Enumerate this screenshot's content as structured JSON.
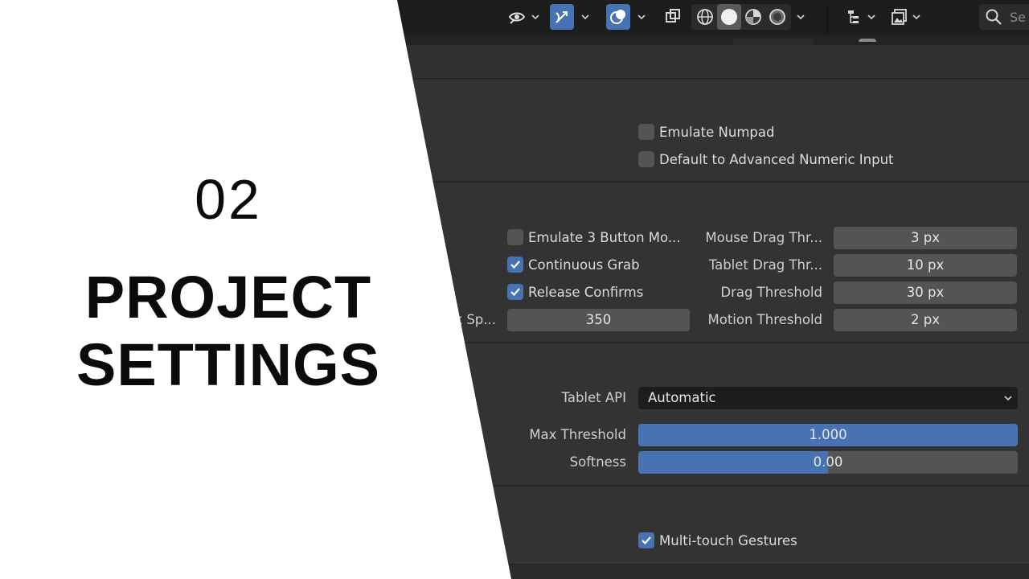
{
  "title_card": {
    "number": "02",
    "heading_line1": "PROJECT",
    "heading_line2": "SETTINGS"
  },
  "toolbar": {
    "search_placeholder": "Se",
    "icons": [
      "visibility-icon",
      "gizmo-icon",
      "overlays-icon",
      "xray-icon",
      "wireframe-shading-icon",
      "solid-shading-icon",
      "material-shading-icon",
      "rendered-shading-icon",
      "outliner-filter-icon",
      "image-view-icon",
      "search-icon"
    ],
    "active_color": "#4772b3"
  },
  "keyboard": {
    "emulate_numpad": {
      "label": "Emulate Numpad",
      "checked": false
    },
    "advanced_numeric_input": {
      "label": "Default to Advanced Numeric Input",
      "checked": false
    }
  },
  "mouse": {
    "emulate_3_button": {
      "label": "Emulate 3 Button Mo...",
      "checked": false
    },
    "continuous_grab": {
      "label": "Continuous Grab",
      "checked": true
    },
    "release_confirms": {
      "label": "Release Confirms",
      "checked": true
    },
    "double_click_label": "k Sp...",
    "double_click_value": "350",
    "mouse_drag_threshold": {
      "label": "Mouse Drag Thr...",
      "value": "3 px"
    },
    "tablet_drag_threshold": {
      "label": "Tablet Drag Thr...",
      "value": "10 px"
    },
    "drag_threshold": {
      "label": "Drag Threshold",
      "value": "30 px"
    },
    "motion_threshold": {
      "label": "Motion Threshold",
      "value": "2 px"
    }
  },
  "tablet": {
    "api": {
      "label": "Tablet API",
      "value": "Automatic"
    },
    "max_threshold": {
      "label": "Max Threshold",
      "value": "1.000",
      "fill": 1.0
    },
    "softness": {
      "label": "Softness",
      "value": "0.00",
      "fill": 0.5
    }
  },
  "touchpad": {
    "multitouch": {
      "label": "Multi-touch Gestures",
      "checked": true
    }
  }
}
